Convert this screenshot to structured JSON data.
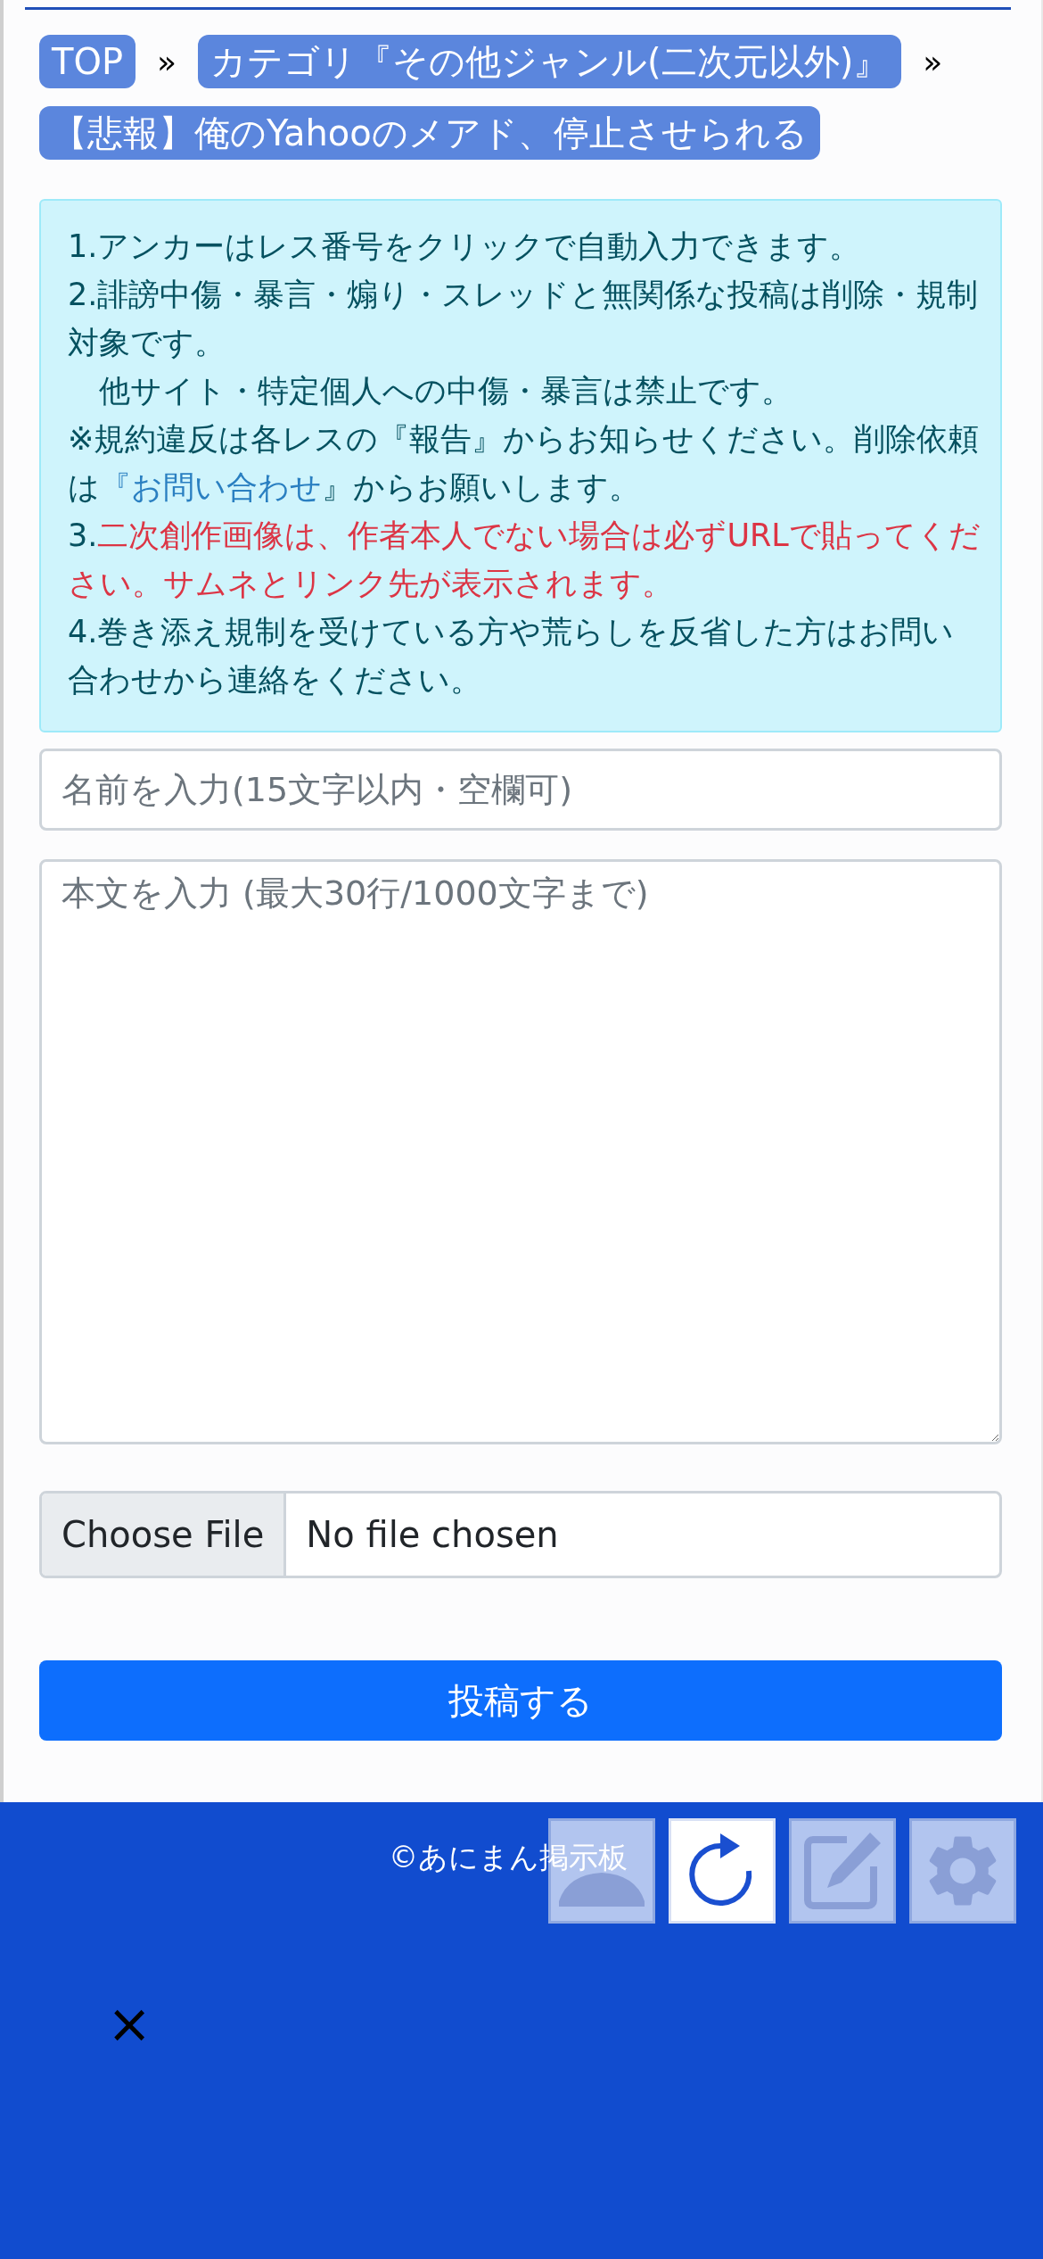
{
  "breadcrumb": {
    "separator": "»",
    "items": [
      {
        "label": "TOP"
      },
      {
        "label": "カテゴリ『その他ジャンル(二次元以外)』"
      },
      {
        "label": "【悲報】俺のYahooのメアド、停止させられる"
      }
    ]
  },
  "notice": [
    [
      {
        "kind": "normal",
        "text": "1.アンカーはレス番号をクリックで自動入力できます。"
      }
    ],
    [
      {
        "kind": "normal",
        "text": "2.誹謗中傷・暴言・煽り・スレッドと無関係な投稿は削除・規制対象です。"
      }
    ],
    [
      {
        "kind": "normal",
        "text": "　他サイト・特定個人への中傷・暴言は禁止です。"
      }
    ],
    [
      {
        "kind": "normal",
        "text": "※規約違反は各レスの『報告』からお知らせください。削除依頼は"
      },
      {
        "kind": "link",
        "text": "『お問い合わせ"
      },
      {
        "kind": "normal",
        "text": "』からお願いします。"
      }
    ],
    [
      {
        "kind": "normal",
        "text": "3."
      },
      {
        "kind": "warning",
        "text": "二次創作画像は、作者本人でない場合は必ずURLで貼ってください。サムネとリンク先が表示されます。"
      }
    ],
    [
      {
        "kind": "normal",
        "text": "4.巻き添え規制を受けている方や荒らしを反省した方はお問い合わせから連絡をください。"
      }
    ]
  ],
  "form": {
    "name": {
      "placeholder": "名前を入力(15文字以内・空欄可)"
    },
    "body": {
      "placeholder": "本文を入力 (最大30行/1000文字まで)"
    },
    "file": {
      "button": "Choose File",
      "status": "No file chosen"
    },
    "submit": "投稿する"
  },
  "footer": {
    "copyright": "©あにまん掲示板",
    "close": "×"
  },
  "float_buttons": [
    {
      "kind": "up",
      "selected": false
    },
    {
      "kind": "reload",
      "selected": true
    },
    {
      "kind": "edit",
      "selected": false
    },
    {
      "kind": "settings",
      "selected": false
    }
  ]
}
